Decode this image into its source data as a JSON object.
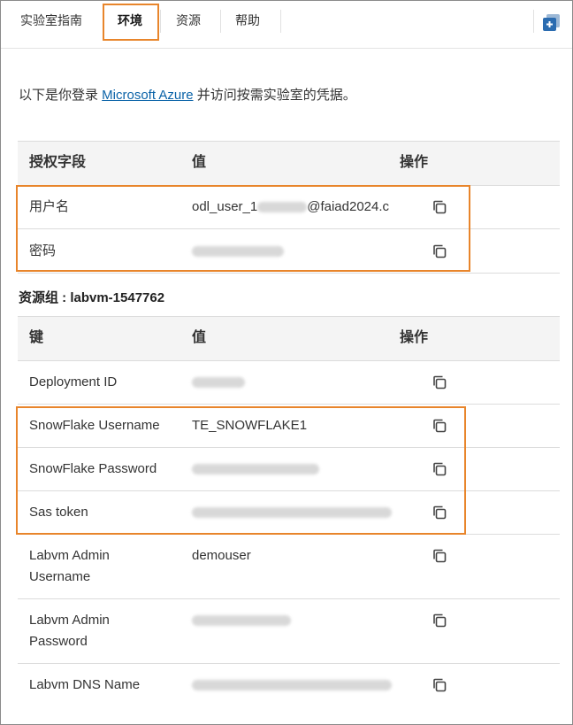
{
  "tabs": [
    {
      "label": "实验室指南"
    },
    {
      "label": "环境"
    },
    {
      "label": "资源"
    },
    {
      "label": "帮助"
    }
  ],
  "intro": {
    "prefix": "以下是你登录 ",
    "link": "Microsoft Azure",
    "suffix": " 并访问按需实验室的凭据。"
  },
  "credentials": {
    "headers": {
      "field": "授权字段",
      "value": "值",
      "action": "操作"
    },
    "rows": [
      {
        "label": "用户名",
        "value_visible_start": "odl_user_1",
        "value_visible_end": "@faiad2024.c"
      },
      {
        "label": "密码",
        "value_visible": ""
      }
    ]
  },
  "resource_group": {
    "label": "资源组 : labvm-1547762"
  },
  "resources": {
    "headers": {
      "key": "键",
      "value": "值",
      "action": "操作"
    },
    "rows": [
      {
        "key": "Deployment ID",
        "value": ""
      },
      {
        "key": "SnowFlake Username",
        "value": "TE_SNOWFLAKE1"
      },
      {
        "key": "SnowFlake Password",
        "value": ""
      },
      {
        "key": "Sas token",
        "value": ""
      },
      {
        "key_line1": "Labvm Admin",
        "key_line2": "Username",
        "value": "demouser"
      },
      {
        "key_line1": "Labvm Admin",
        "key_line2": "Password",
        "value": ""
      },
      {
        "key": "Labvm DNS Name",
        "value": ""
      }
    ]
  },
  "colors": {
    "highlight": "#e8852b",
    "link": "#0b63a8",
    "corner_icon": "#2b6cb0"
  }
}
